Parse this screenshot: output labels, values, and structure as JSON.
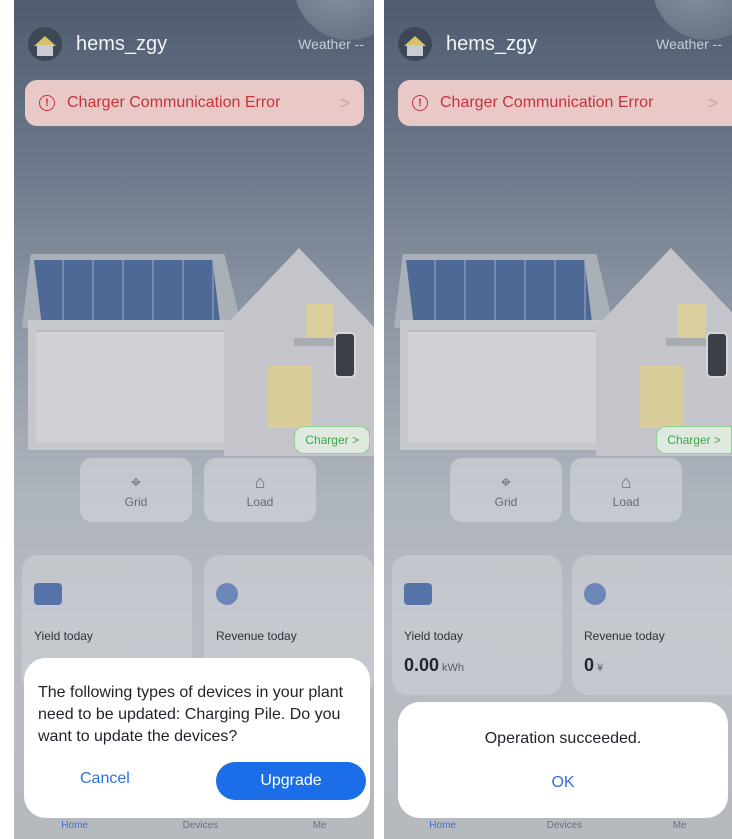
{
  "left": {
    "username": "hems_zgy",
    "weather": "Weather --",
    "alert": {
      "icon": "error-circle-icon",
      "text": "Charger Communication Error",
      "chevron": ">"
    },
    "charger_button": "Charger >",
    "tiles": [
      {
        "icon": "transmission-tower-icon",
        "label": "Grid"
      },
      {
        "icon": "house-load-icon",
        "label": "Load"
      }
    ],
    "stats": [
      {
        "icon": "solar-panel-icon",
        "label": "Yield today"
      },
      {
        "icon": "coins-icon",
        "label": "Revenue today"
      }
    ],
    "nav": [
      "Home",
      "Devices",
      "Me"
    ],
    "dialog": {
      "message": "The following types of devices in your plant need to be updated: Charging Pile. Do you want to update the devices?",
      "cancel": "Cancel",
      "confirm": "Upgrade"
    }
  },
  "right": {
    "username": "hems_zgy",
    "weather": "Weather --",
    "alert": {
      "icon": "error-circle-icon",
      "text": "Charger Communication Error",
      "chevron": ">"
    },
    "charger_button": "Charger >",
    "tiles": [
      {
        "icon": "transmission-tower-icon",
        "label": "Grid"
      },
      {
        "icon": "house-load-icon",
        "label": "Load"
      }
    ],
    "stats": [
      {
        "icon": "solar-panel-icon",
        "label": "Yield today",
        "value": "0.00",
        "unit": "kWh"
      },
      {
        "icon": "coins-icon",
        "label": "Revenue today",
        "value": "0",
        "unit": "¥"
      }
    ],
    "nav": [
      "Home",
      "Devices",
      "Me"
    ],
    "dialog": {
      "message": "Operation succeeded.",
      "ok": "OK"
    }
  },
  "colors": {
    "alert_red": "#c8323a",
    "accent_blue": "#1c6ee8",
    "charger_green": "#3fa548"
  }
}
